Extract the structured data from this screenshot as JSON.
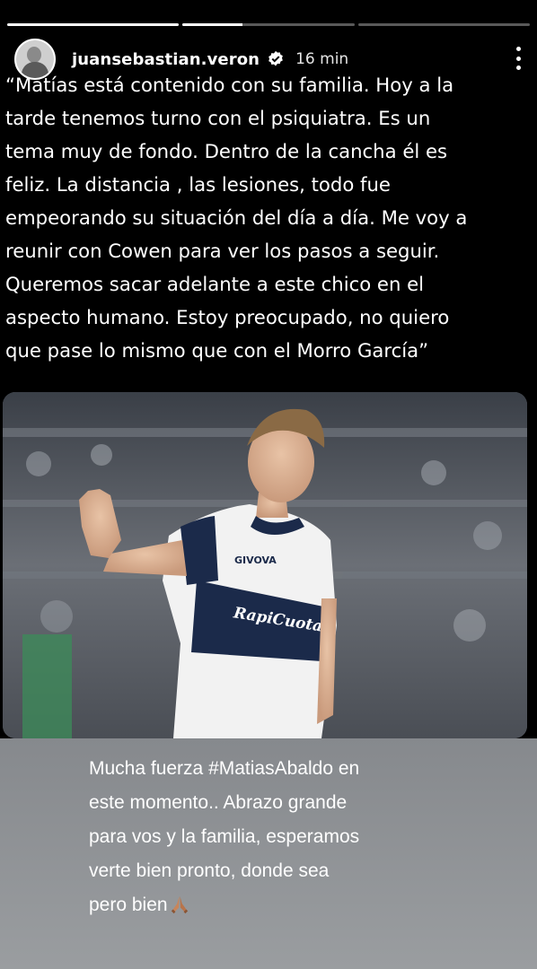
{
  "story": {
    "segments": [
      {
        "state": "done"
      },
      {
        "state": "active"
      },
      {
        "state": "pending"
      }
    ],
    "progress_fraction": 0.35
  },
  "header": {
    "username": "juansebastian.veron",
    "time": "16 min",
    "verified": true
  },
  "quote_lines": [
    "“Matías está contenido con su familia. Hoy a la",
    "tarde tenemos turno con el psiquiatra. Es un",
    "tema muy de fondo. Dentro de la cancha él es",
    "feliz. La distancia , las lesiones, todo fue",
    "empeorando su situación del día a día. Me voy a",
    "reunir con Cowen para ver los pasos a seguir.",
    "Queremos sacar adelante a este chico en el",
    "aspecto humano. Estoy preocupado, no quiero",
    "que pase lo mismo que con el Morro García”"
  ],
  "photo": {
    "jersey_brand": "GIVOVA",
    "jersey_sponsor": "RapiCuota"
  },
  "caption": {
    "pre": "Mucha fuerza ",
    "hashtag": "#MatiasAbaldo",
    "lines_after": [
      " en",
      "este momento.. Abrazo grande",
      "para vos y la familia, esperamos",
      "verte bien pronto, donde sea",
      "pero bien"
    ],
    "emoji": "folded-hands"
  },
  "colors": {
    "background": "#000000",
    "lower_panel": "#8e9195",
    "jersey_blue": "#1b2a4a"
  }
}
